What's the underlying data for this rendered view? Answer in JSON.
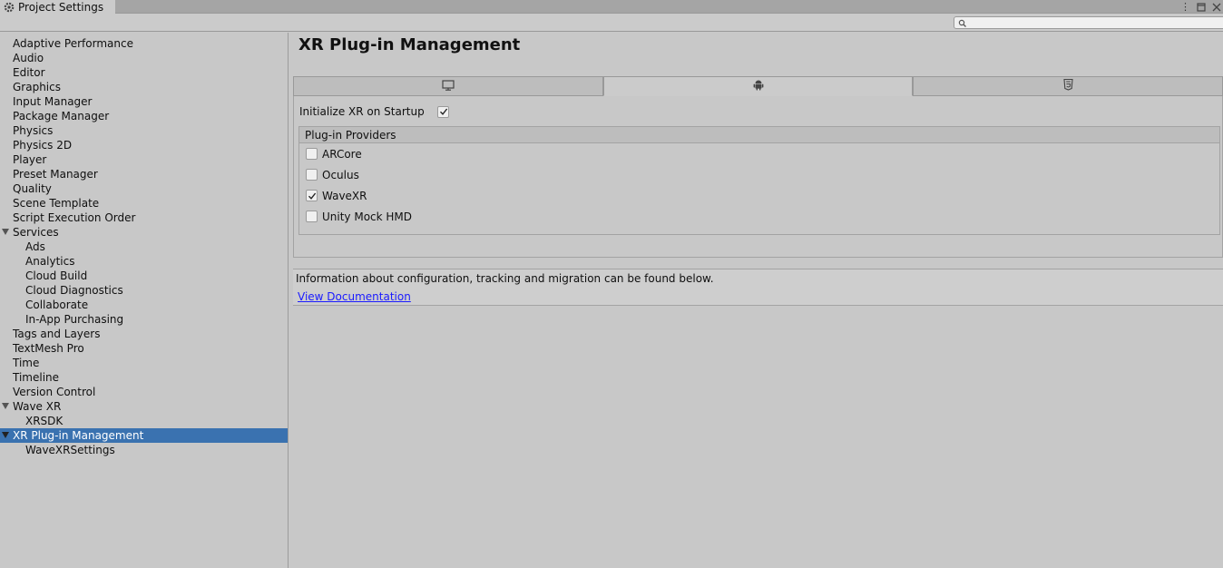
{
  "window": {
    "tab_title": "Project Settings",
    "controls": [
      "more-icon",
      "maximize-icon",
      "close-icon"
    ]
  },
  "search": {
    "placeholder": "",
    "value": ""
  },
  "sidebar": {
    "items": [
      {
        "label": "Adaptive Performance",
        "level": 0
      },
      {
        "label": "Audio",
        "level": 0
      },
      {
        "label": "Editor",
        "level": 0
      },
      {
        "label": "Graphics",
        "level": 0
      },
      {
        "label": "Input Manager",
        "level": 0
      },
      {
        "label": "Package Manager",
        "level": 0
      },
      {
        "label": "Physics",
        "level": 0
      },
      {
        "label": "Physics 2D",
        "level": 0
      },
      {
        "label": "Player",
        "level": 0
      },
      {
        "label": "Preset Manager",
        "level": 0
      },
      {
        "label": "Quality",
        "level": 0
      },
      {
        "label": "Scene Template",
        "level": 0
      },
      {
        "label": "Script Execution Order",
        "level": 0
      },
      {
        "label": "Services",
        "level": 0,
        "expanded": true
      },
      {
        "label": "Ads",
        "level": 1
      },
      {
        "label": "Analytics",
        "level": 1
      },
      {
        "label": "Cloud Build",
        "level": 1
      },
      {
        "label": "Cloud Diagnostics",
        "level": 1
      },
      {
        "label": "Collaborate",
        "level": 1
      },
      {
        "label": "In-App Purchasing",
        "level": 1
      },
      {
        "label": "Tags and Layers",
        "level": 0
      },
      {
        "label": "TextMesh Pro",
        "level": 0
      },
      {
        "label": "Time",
        "level": 0
      },
      {
        "label": "Timeline",
        "level": 0
      },
      {
        "label": "Version Control",
        "level": 0
      },
      {
        "label": "Wave XR",
        "level": 0,
        "expanded": true
      },
      {
        "label": "XRSDK",
        "level": 1
      },
      {
        "label": "XR Plug-in Management",
        "level": 0,
        "expanded": true,
        "selected": true
      },
      {
        "label": "WaveXRSettings",
        "level": 1
      }
    ]
  },
  "main": {
    "title": "XR Plug-in Management",
    "platform_tabs": [
      {
        "icon": "monitor-icon",
        "active": false
      },
      {
        "icon": "android-icon",
        "active": true
      },
      {
        "icon": "html5-icon",
        "active": false
      }
    ],
    "init_label": "Initialize XR on Startup",
    "init_checked": true,
    "providers_header": "Plug-in Providers",
    "providers": [
      {
        "label": "ARCore",
        "checked": false
      },
      {
        "label": "Oculus",
        "checked": false
      },
      {
        "label": "WaveXR",
        "checked": true
      },
      {
        "label": "Unity Mock HMD",
        "checked": false
      }
    ],
    "info_text": "Information about configuration, tracking and migration can be found below.",
    "doc_link": "View Documentation"
  },
  "colors": {
    "selection": "#3a72b0",
    "background": "#c8c8c8",
    "link": "#1a1aff"
  }
}
